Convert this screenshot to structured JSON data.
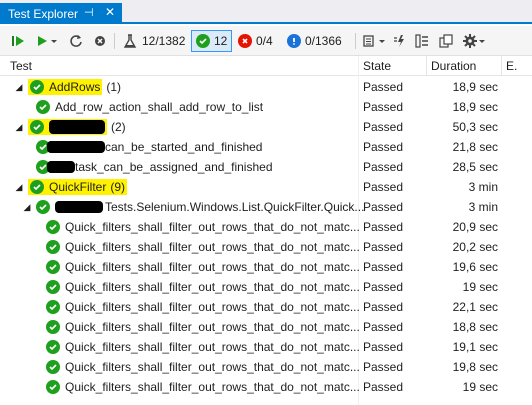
{
  "tab": {
    "title": "Test Explorer",
    "pin": "⊣",
    "close": "✕"
  },
  "toolbar": {
    "flask_count": "12/1382",
    "passed_count": "12",
    "failed_count": "0/4",
    "notrun_count": "0/1366"
  },
  "columns": {
    "test": "Test",
    "state": "State",
    "duration": "Duration",
    "e": "E."
  },
  "groups": {
    "addrows": {
      "name": "AddRows",
      "count": "(1)",
      "state": "Passed",
      "duration": "18,9 sec"
    },
    "addrows_child": {
      "name": "Add_row_action_shall_add_row_to_list",
      "state": "Passed",
      "duration": "18,9 sec"
    },
    "redacted": {
      "name": "",
      "count": "(2)",
      "state": "Passed",
      "duration": "50,3 sec"
    },
    "redacted_child1": {
      "name": "can_be_started_and_finished",
      "state": "Passed",
      "duration": "21,8 sec"
    },
    "redacted_child2": {
      "name": "task_can_be_assigned_and_finished",
      "state": "Passed",
      "duration": "28,5 sec"
    },
    "quickfilter": {
      "name": "QuickFilter",
      "count": "(9)",
      "state": "Passed",
      "duration": "3 min"
    },
    "quickfilter_class": {
      "name": "Tests.Selenium.Windows.List.QuickFilter.Quick...",
      "state": "Passed",
      "duration": "3 min"
    }
  },
  "quick_tests": [
    {
      "name": "Quick_filters_shall_filter_out_rows_that_do_not_matc...",
      "state": "Passed",
      "duration": "20,9 sec"
    },
    {
      "name": "Quick_filters_shall_filter_out_rows_that_do_not_matc...",
      "state": "Passed",
      "duration": "20,2 sec"
    },
    {
      "name": "Quick_filters_shall_filter_out_rows_that_do_not_matc...",
      "state": "Passed",
      "duration": "19,6 sec"
    },
    {
      "name": "Quick_filters_shall_filter_out_rows_that_do_not_matc...",
      "state": "Passed",
      "duration": "19 sec"
    },
    {
      "name": "Quick_filters_shall_filter_out_rows_that_do_not_matc...",
      "state": "Passed",
      "duration": "22,1 sec"
    },
    {
      "name": "Quick_filters_shall_filter_out_rows_that_do_not_matc...",
      "state": "Passed",
      "duration": "18,8 sec"
    },
    {
      "name": "Quick_filters_shall_filter_out_rows_that_do_not_matc...",
      "state": "Passed",
      "duration": "19,1 sec"
    },
    {
      "name": "Quick_filters_shall_filter_out_rows_that_do_not_matc...",
      "state": "Passed",
      "duration": "19,8 sec"
    },
    {
      "name": "Quick_filters_shall_filter_out_rows_that_do_not_matc...",
      "state": "Passed",
      "duration": "19 sec"
    }
  ],
  "colors": {
    "accent": "#007acc",
    "passed": "#1ea01e",
    "failed": "#e51400",
    "highlight": "#fff200"
  }
}
